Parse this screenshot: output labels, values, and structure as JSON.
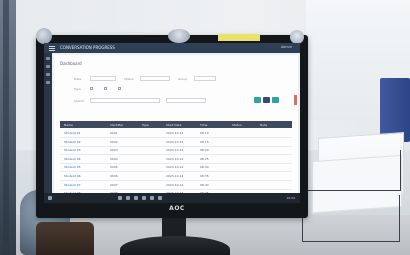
{
  "monitor": {
    "brand": "AOC",
    "sticky_note": "—"
  },
  "app": {
    "title": "CONVERSATION PROGRESS",
    "user": "Admin",
    "breadcrumb": "Dashboard",
    "filters": {
      "labels": [
        "Date",
        "Type",
        "Status",
        "Group"
      ],
      "search_label": "Search",
      "buttons": [
        "Q",
        "+",
        "↻"
      ]
    },
    "table": {
      "columns": [
        "Name",
        "Identifier",
        "Type",
        "Start Date",
        "Time",
        "Status",
        "Note"
      ],
      "rows": [
        {
          "name": "Student 01",
          "id": "0001",
          "date": "2023-10-12",
          "time": "08:10"
        },
        {
          "name": "Student 02",
          "id": "0002",
          "date": "2023-10-12",
          "time": "08:15"
        },
        {
          "name": "Student 03",
          "id": "0003",
          "date": "2023-10-12",
          "time": "08:20"
        },
        {
          "name": "Student 04",
          "id": "0004",
          "date": "2023-10-12",
          "time": "08:25"
        },
        {
          "name": "Student 05",
          "id": "0005",
          "date": "2023-10-12",
          "time": "08:30"
        },
        {
          "name": "Student 06",
          "id": "0006",
          "date": "2023-10-12",
          "time": "08:35"
        },
        {
          "name": "Student 07",
          "id": "0007",
          "date": "2023-10-12",
          "time": "08:40"
        },
        {
          "name": "Student 08",
          "id": "0008",
          "date": "2023-10-12",
          "time": "08:45"
        }
      ]
    },
    "taskbar_clock": "10:24"
  },
  "colors": {
    "header": "#2f3f56",
    "link": "#2f6fb0",
    "accent_red": "#e56b6b",
    "button_teal": "#2aa6a1",
    "button_navy": "#334d73"
  }
}
